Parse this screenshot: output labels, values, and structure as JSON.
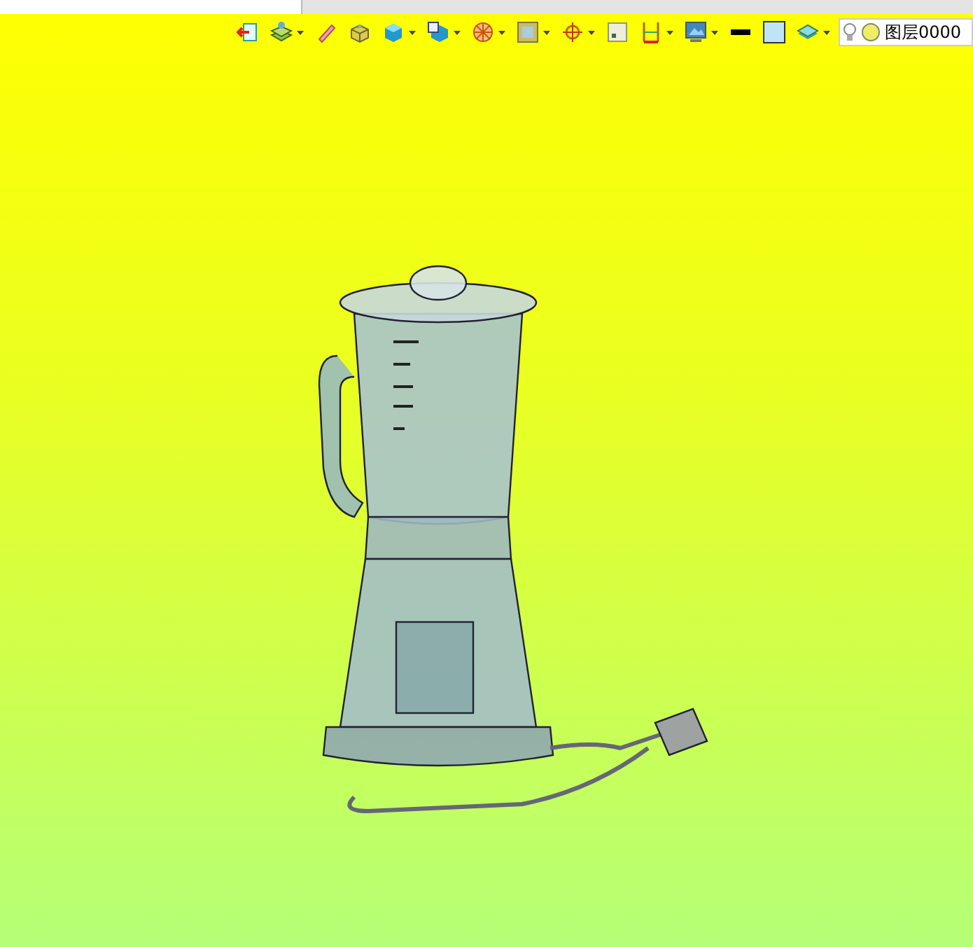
{
  "toolbar": {
    "tools": [
      {
        "kind": "exit",
        "dropdown": false
      },
      {
        "kind": "layers",
        "dropdown": true
      },
      {
        "kind": "eraser",
        "dropdown": false
      },
      {
        "kind": "box",
        "dropdown": false
      },
      {
        "kind": "cube",
        "dropdown": true
      },
      {
        "kind": "cube-doc",
        "dropdown": true
      },
      {
        "kind": "wheel",
        "dropdown": true
      },
      {
        "kind": "frame",
        "dropdown": true
      },
      {
        "kind": "target",
        "dropdown": true
      },
      {
        "kind": "square",
        "dropdown": false
      },
      {
        "kind": "dimension",
        "dropdown": true
      },
      {
        "kind": "monitor",
        "dropdown": true
      },
      {
        "kind": "line-color",
        "dropdown": false
      },
      {
        "kind": "fill-color",
        "dropdown": false
      },
      {
        "kind": "stack",
        "dropdown": true
      }
    ],
    "layer_field": {
      "value": "图层0000"
    }
  }
}
